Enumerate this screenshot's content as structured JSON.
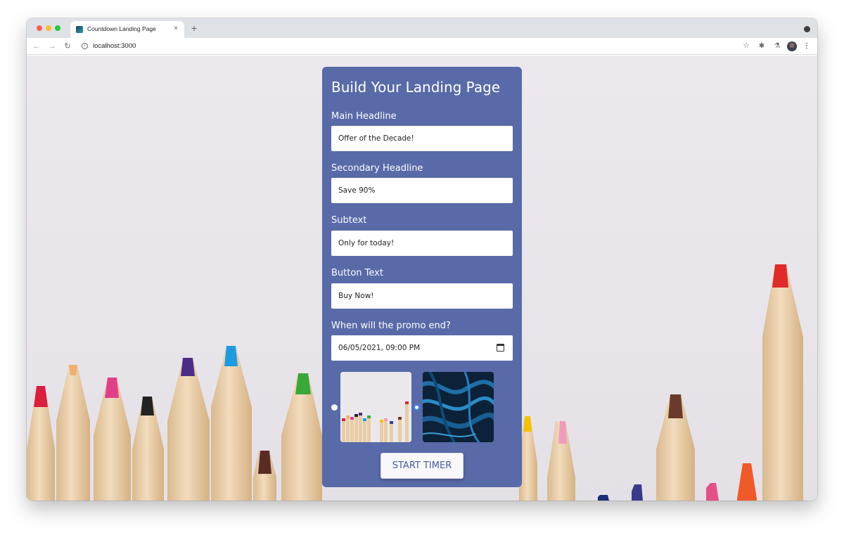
{
  "browser": {
    "tab_title": "Countdown Landing Page",
    "tab_close": "×",
    "new_tab": "+",
    "url": "localhost:3000",
    "nav_back": "←",
    "nav_forward": "→",
    "reload": "↻",
    "star": "☆",
    "extensions": "✱",
    "labs": "⚗",
    "menu": "⋮",
    "info": "i"
  },
  "form": {
    "title": "Build Your Landing Page",
    "fields": [
      {
        "label": "Main Headline",
        "value": "Offer of the Decade!"
      },
      {
        "label": "Secondary Headline",
        "value": "Save 90%"
      },
      {
        "label": "Subtext",
        "value": "Only for today!"
      },
      {
        "label": "Button Text",
        "value": "Buy Now!"
      },
      {
        "label": "When will the promo end?",
        "value": "06/05/2021, 09:00 PM"
      }
    ],
    "background_options": [
      {
        "name": "pencils",
        "selected": false
      },
      {
        "name": "blue-abstract",
        "selected": true
      }
    ],
    "submit_label": "START TIMER"
  },
  "colors": {
    "card": "#586aa8",
    "accent": "#3b82f6"
  }
}
